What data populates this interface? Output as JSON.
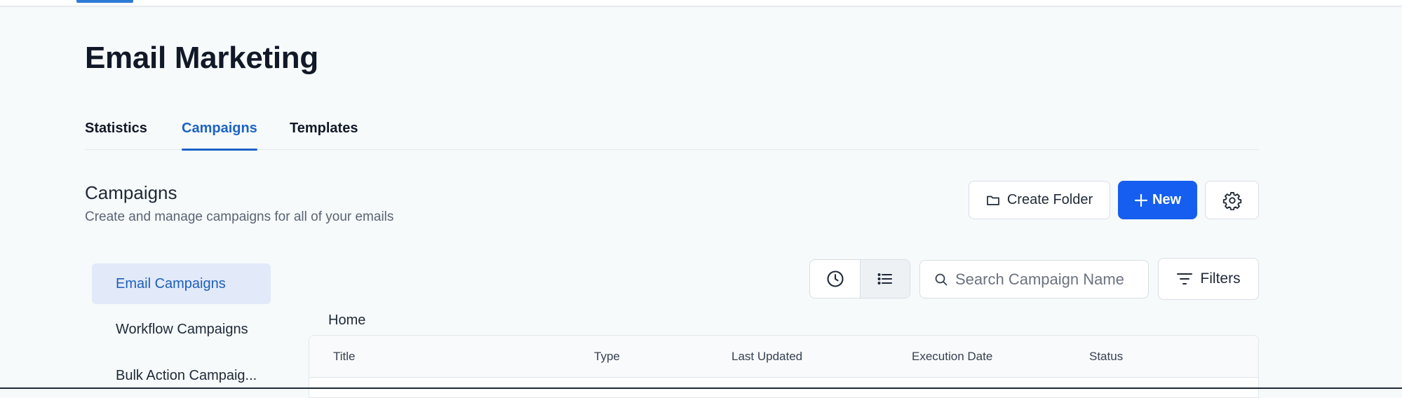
{
  "app": {
    "title": "Email Marketing"
  },
  "tabs": [
    {
      "label": "Statistics",
      "active": false
    },
    {
      "label": "Campaigns",
      "active": true
    },
    {
      "label": "Templates",
      "active": false
    }
  ],
  "section": {
    "title": "Campaigns",
    "subtitle": "Create and manage campaigns for all of your emails"
  },
  "actions": {
    "create_folder_label": "Create Folder",
    "create_folder_icon": "folder-icon",
    "new_label": "New",
    "new_icon": "plus-icon",
    "settings_icon": "gear-icon"
  },
  "sidebar": {
    "items": [
      {
        "label": "Email Campaigns",
        "active": true
      },
      {
        "label": "Workflow Campaigns",
        "active": false
      },
      {
        "label": "Bulk Action Campaig...",
        "active": false
      }
    ]
  },
  "toolbar": {
    "history_icon": "clock-icon",
    "list_icon": "list-icon",
    "list_view_selected": true,
    "search_placeholder": "Search Campaign Name",
    "search_value": "",
    "filters_label": "Filters",
    "filters_icon": "filter-icon"
  },
  "breadcrumb": {
    "label": "Home"
  },
  "table": {
    "columns": [
      "Title",
      "Type",
      "Last Updated",
      "Execution Date",
      "Status"
    ]
  },
  "colors": {
    "accent": "#155eef",
    "active_tab": "#1d63c4",
    "active_sidebar_bg": "#e2e9f9",
    "page_bg": "#f6fafb"
  }
}
